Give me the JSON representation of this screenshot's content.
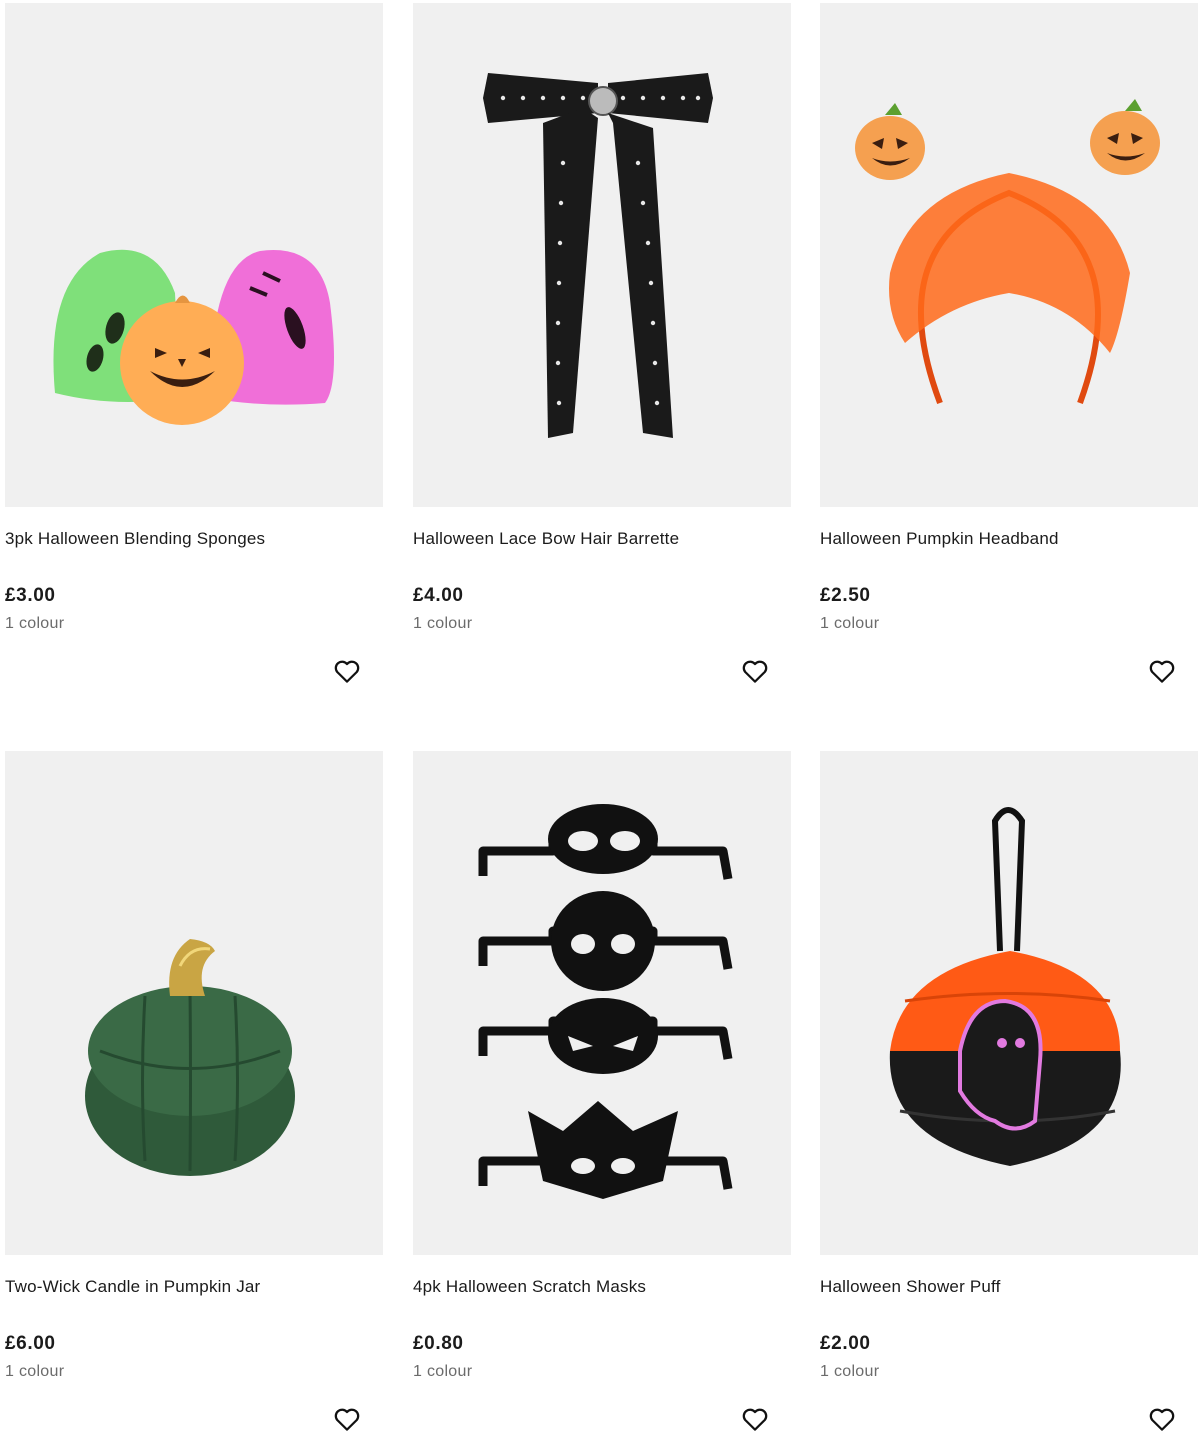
{
  "products": [
    {
      "title": "3pk Halloween Blending Sponges",
      "price": "£3.00",
      "colours": "1 colour",
      "image_icon": "blending-sponges-image",
      "wishlist_icon": "heart-icon"
    },
    {
      "title": "Halloween Lace Bow Hair Barrette",
      "price": "£4.00",
      "colours": "1 colour",
      "image_icon": "lace-bow-image",
      "wishlist_icon": "heart-icon"
    },
    {
      "title": "Halloween Pumpkin Headband",
      "price": "£2.50",
      "colours": "1 colour",
      "image_icon": "pumpkin-headband-image",
      "wishlist_icon": "heart-icon"
    },
    {
      "title": "Two-Wick Candle in Pumpkin Jar",
      "price": "£6.00",
      "colours": "1 colour",
      "image_icon": "pumpkin-candle-image",
      "wishlist_icon": "heart-icon"
    },
    {
      "title": "4pk Halloween Scratch Masks",
      "price": "£0.80",
      "colours": "1 colour",
      "image_icon": "scratch-masks-image",
      "wishlist_icon": "heart-icon"
    },
    {
      "title": "Halloween Shower Puff",
      "price": "£2.00",
      "colours": "1 colour",
      "image_icon": "shower-puff-image",
      "wishlist_icon": "heart-icon"
    }
  ],
  "colors": {
    "image_background": "#f0f0f0",
    "text_primary": "#1b1b1b",
    "text_secondary": "#6b6b6b"
  }
}
